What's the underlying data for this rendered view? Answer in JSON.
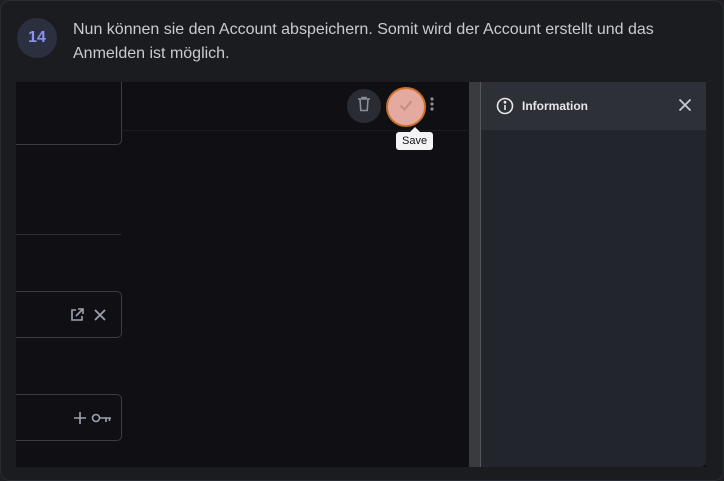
{
  "step": {
    "number": "14",
    "text": "Nun können sie den Account abspeichern. Somit wird der Account erstellt und das Anmelden ist möglich."
  },
  "toolbar": {
    "delete_icon": "trash-icon",
    "save_icon": "check-icon",
    "more_icon": "kebab-icon",
    "save_tooltip": "Save"
  },
  "fields": [
    {
      "icons": []
    },
    {
      "icons": [
        "open-external-icon",
        "close-icon"
      ]
    },
    {
      "icons": [
        "plus-icon",
        "key-icon"
      ]
    }
  ],
  "info_panel": {
    "title": "Information",
    "icon": "info-icon",
    "close_icon": "close-icon"
  },
  "colors": {
    "accent_step": "#8b92f5",
    "save_fill": "#e4aaa0",
    "save_ring": "#c8722d"
  }
}
